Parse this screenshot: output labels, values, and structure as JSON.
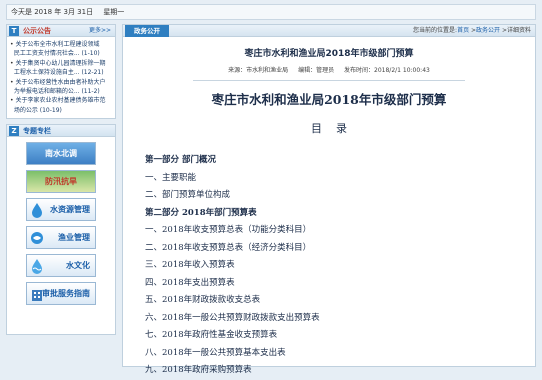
{
  "topbar": {
    "date": "今天是 2018 年 3月 31日",
    "weekday": "星期一"
  },
  "notice": {
    "title": "公示公告",
    "more": "更多>>",
    "items": [
      {
        "text": "关于公布全市水利工程建设领域",
        "date": ""
      },
      {
        "text": "民工工资支付情况社会... (1-10)",
        "date": ""
      },
      {
        "text": "关于集贤中心幼儿园清理拆除一期",
        "date": ""
      },
      {
        "text": "工程水土保持设施自主... (12-21)",
        "date": ""
      },
      {
        "text": "关于公布经营性水由由者补助大户",
        "date": ""
      },
      {
        "text": "为举报电话和邮箱的公... (11-2)",
        "date": ""
      },
      {
        "text": "关于李家农业农村基建债务雄市范",
        "date": ""
      },
      {
        "text": "场的公示 (10-19)",
        "date": ""
      }
    ]
  },
  "special": {
    "title": "专题专栏",
    "banners": [
      {
        "label": "南水北调",
        "icon": "water-transfer-icon"
      },
      {
        "label": "防汛抗旱",
        "icon": "flood-icon"
      },
      {
        "label": "水资源管理",
        "icon": "water-drop-icon"
      },
      {
        "label": "渔业管理",
        "icon": "fish-icon"
      },
      {
        "label": "水文化",
        "icon": "wave-icon"
      },
      {
        "label": "审批服务指南",
        "icon": "building-icon"
      }
    ]
  },
  "main": {
    "tab": "政务公开",
    "breadcrumb": {
      "prefix": "您当前的位置是:",
      "home": "首页",
      "sep1": " >",
      "section": "政务公开",
      "sep2": " >",
      "current": "详细资料"
    },
    "article": {
      "title": "枣庄市水利和渔业局2018年市级部门预算",
      "source": "来源：市水利和渔业局",
      "editor": "编辑：管理员",
      "published": "发布时间：2018/2/1 10:00:43"
    },
    "doc_title": "枣庄市水利和渔业局2018年市级部门预算",
    "toc_heading": "目录",
    "toc": [
      {
        "text": "第一部分  部门概况",
        "part": true
      },
      {
        "text": "一、主要职能",
        "part": false
      },
      {
        "text": "二、部门预算单位构成",
        "part": false
      },
      {
        "text": "第二部分  2018年部门预算表",
        "part": true
      },
      {
        "text": "一、2018年收支预算总表（功能分类科目）",
        "part": false
      },
      {
        "text": "二、2018年收支预算总表（经济分类科目）",
        "part": false
      },
      {
        "text": "三、2018年收入预算表",
        "part": false
      },
      {
        "text": "四、2018年支出预算表",
        "part": false
      },
      {
        "text": "五、2018年财政拨款收支总表",
        "part": false
      },
      {
        "text": "六、2018年一般公共预算财政拨款支出预算表",
        "part": false
      },
      {
        "text": "七、2018年政府性基金收支预算表",
        "part": false
      },
      {
        "text": "八、2018年一般公共预算基本支出表",
        "part": false
      },
      {
        "text": "九、2018年政府采购预算表",
        "part": false
      }
    ]
  }
}
